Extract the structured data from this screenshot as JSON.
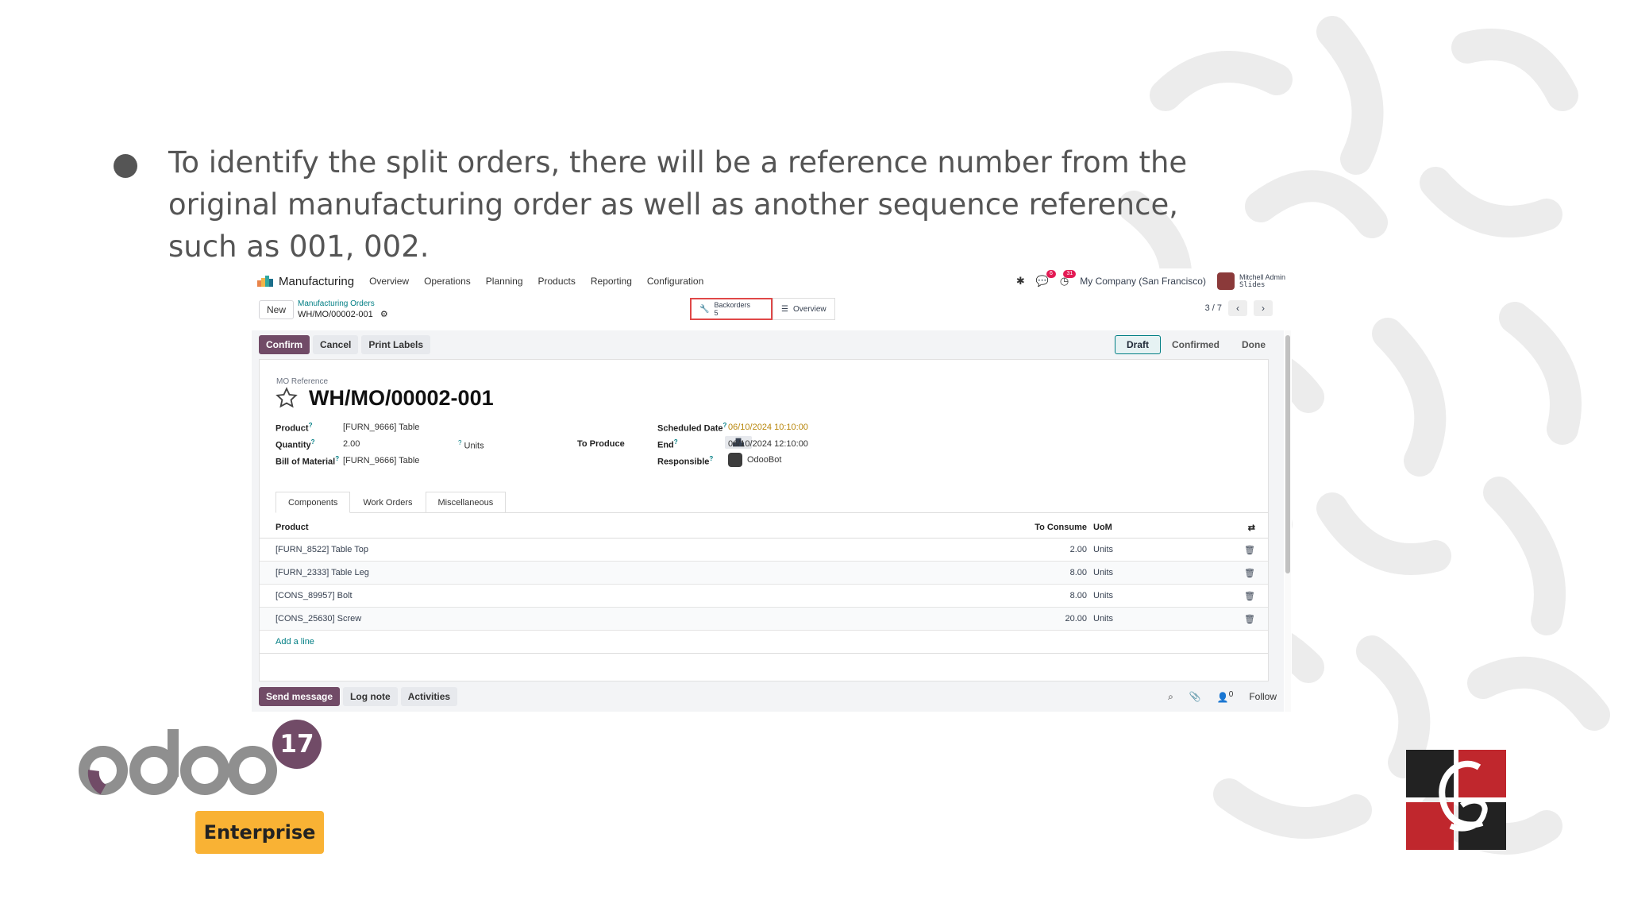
{
  "slide": {
    "bullet": "To identify the split orders, there will be a reference number from the original manufacturing order as well as another sequence reference, such as 001, 002."
  },
  "odoo": {
    "app_name": "Manufacturing",
    "menu": [
      "Overview",
      "Operations",
      "Planning",
      "Products",
      "Reporting",
      "Configuration"
    ],
    "chat_badge": "6",
    "activity_badge": "31",
    "company": "My Company (San Francisco)",
    "user_name": "Mitchell Admin",
    "user_db": "Slides",
    "new_label": "New",
    "breadcrumb_parent": "Manufacturing Orders",
    "breadcrumb_current": "WH/MO/00002-001",
    "smart_backorders_label": "Backorders",
    "smart_backorders_count": "5",
    "smart_overview_label": "Overview",
    "pager": "3 / 7",
    "actions": {
      "confirm": "Confirm",
      "cancel": "Cancel",
      "print_labels": "Print Labels"
    },
    "stages": {
      "draft": "Draft",
      "confirmed": "Confirmed",
      "done": "Done"
    },
    "form": {
      "mo_ref_label": "MO Reference",
      "title": "WH/MO/00002-001",
      "product_label": "Product",
      "product_value": "[FURN_9666] Table",
      "quantity_label": "Quantity",
      "quantity_value": "2.00",
      "quantity_uom": "Units",
      "to_produce_label": "To Produce",
      "bom_label": "Bill of Material",
      "bom_value": "[FURN_9666] Table",
      "scheduled_label": "Scheduled Date",
      "scheduled_value": "06/10/2024 10:10:00",
      "end_label": "End",
      "end_value": "06/10/2024 12:10:00",
      "responsible_label": "Responsible",
      "responsible_value": "OdooBot"
    },
    "tabs": [
      "Components",
      "Work Orders",
      "Miscellaneous"
    ],
    "table": {
      "headers": {
        "product": "Product",
        "to_consume": "To Consume",
        "uom": "UoM"
      },
      "rows": [
        {
          "product": "[FURN_8522] Table Top",
          "to_consume": "2.00",
          "uom": "Units"
        },
        {
          "product": "[FURN_2333] Table Leg",
          "to_consume": "8.00",
          "uom": "Units"
        },
        {
          "product": "[CONS_89957] Bolt",
          "to_consume": "8.00",
          "uom": "Units"
        },
        {
          "product": "[CONS_25630] Screw",
          "to_consume": "20.00",
          "uom": "Units"
        }
      ],
      "add_line": "Add a line"
    },
    "chatter": {
      "send_message": "Send message",
      "log_note": "Log note",
      "activities": "Activities",
      "followers_count": "0",
      "follow": "Follow"
    }
  },
  "logos": {
    "version": "17",
    "edition": "Enterprise"
  },
  "colors": {
    "odoo_primary": "#714b67",
    "odoo_teal": "#017e84",
    "enterprise_yellow": "#f9b234",
    "cs_red": "#c0272d"
  }
}
